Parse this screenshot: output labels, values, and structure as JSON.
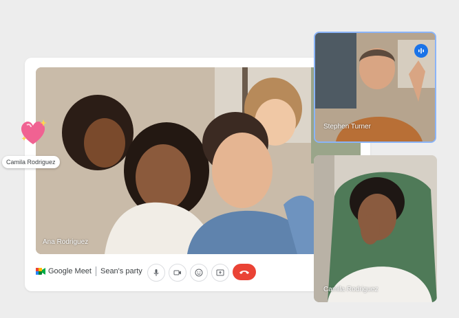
{
  "main_video": {
    "participant_name": "Ana Rodriguez"
  },
  "toolbar": {
    "app_name": "Google Meet",
    "meeting_title": "Sean's party",
    "buttons": [
      "mic-icon",
      "camera-icon",
      "emoji-icon",
      "present-icon",
      "end-call-icon"
    ]
  },
  "tiles": [
    {
      "participant_name": "Stephen Turner",
      "speaking": true
    },
    {
      "participant_name": "Camila Rodriguez"
    }
  ],
  "reaction": {
    "sender_name": "Camila Rodriguez",
    "emoji": "sparkling-heart-icon"
  },
  "colors": {
    "end_call": "#ea4335",
    "speaking": "#1a73e8",
    "active_border": "#8ab4f8"
  }
}
